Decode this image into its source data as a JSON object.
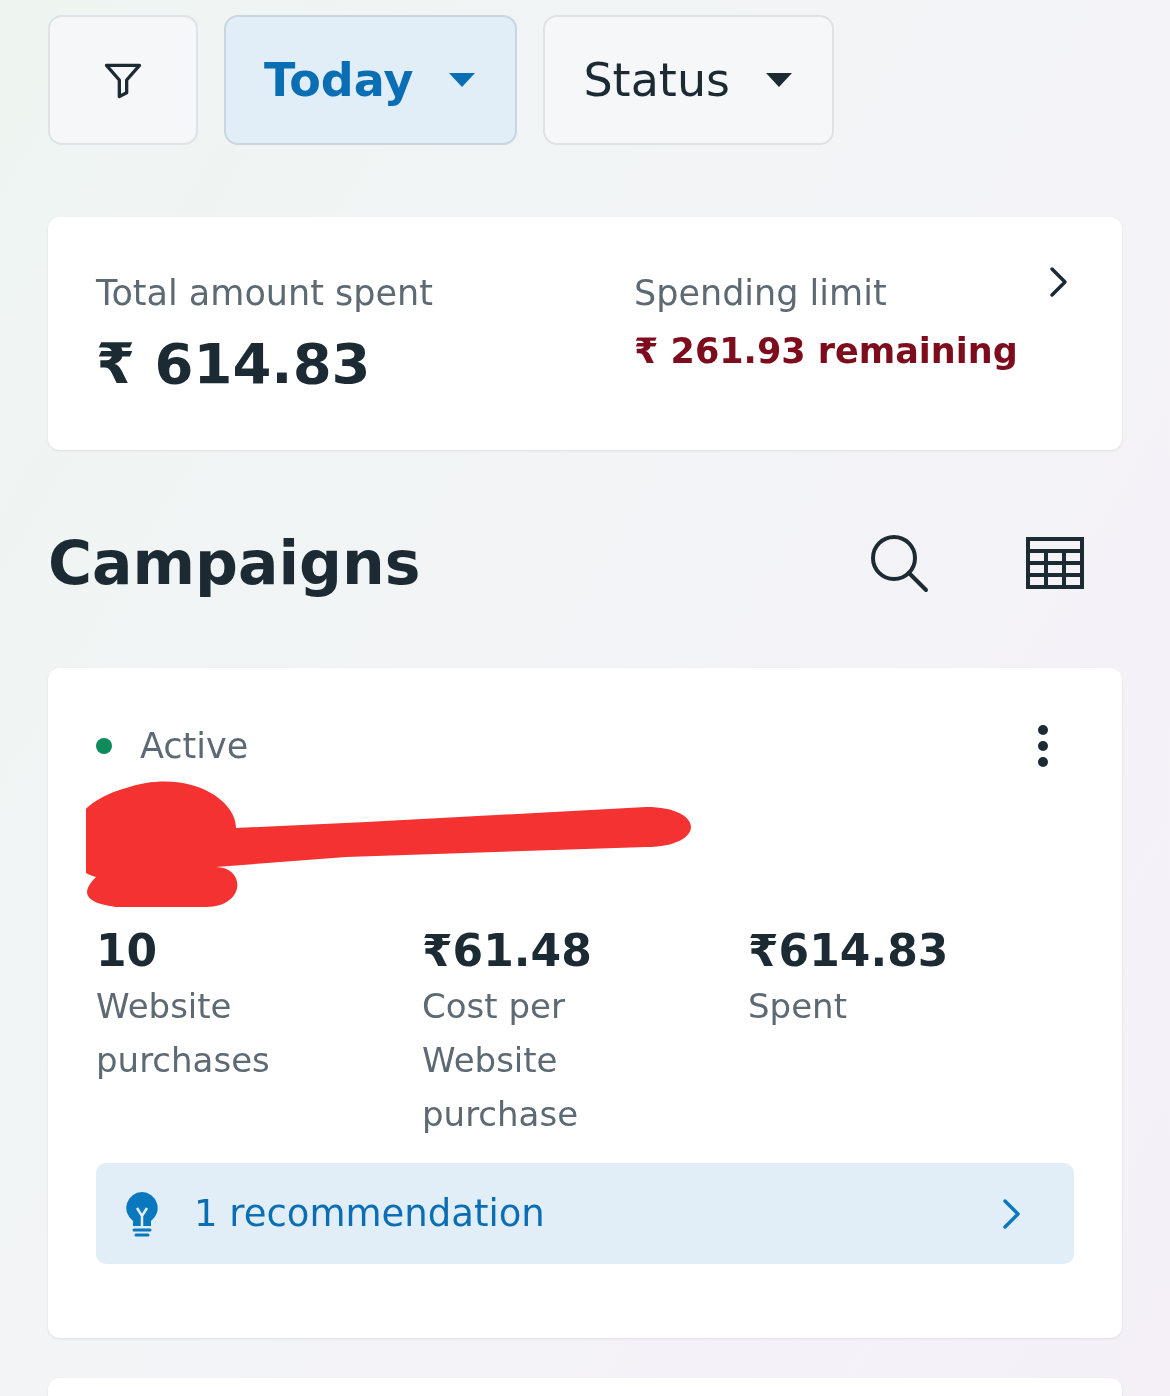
{
  "filters": [
    {
      "kind": "icon",
      "selected": false
    },
    {
      "kind": "dropdown",
      "label": "Today",
      "selected": true
    },
    {
      "kind": "dropdown",
      "label": "Status",
      "selected": false
    }
  ],
  "summary": {
    "total_label": "Total amount spent",
    "total_value": "₹ 614.83",
    "limit_label": "Spending limit",
    "limit_value": "₹ 261.93 remaining"
  },
  "campaigns": {
    "title": "Campaigns"
  },
  "campaign": {
    "status": "Active",
    "color": "#0e8a5c",
    "metrics": [
      {
        "value": "10",
        "label": "Website purchases"
      },
      {
        "value": "₹61.48",
        "label": "Cost per Website purchase"
      },
      {
        "value": "₹614.83",
        "label": "Spent"
      }
    ],
    "recommendation": "1 recommendation"
  }
}
